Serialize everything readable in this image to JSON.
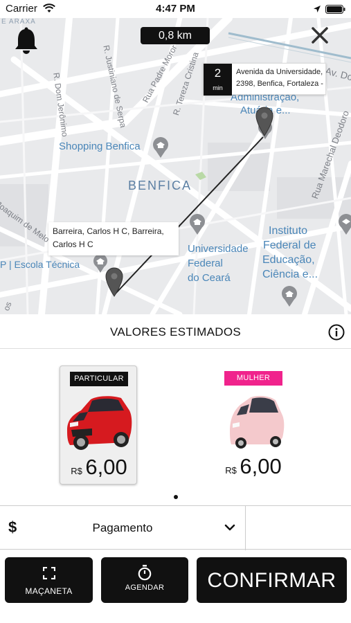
{
  "status_bar": {
    "carrier": "Carrier",
    "time": "4:47 PM",
    "icons": [
      "wifi-icon",
      "location-arrow-icon",
      "battery-icon"
    ]
  },
  "map": {
    "distance": "0,8 km",
    "destination": {
      "eta_value": "2",
      "eta_unit": "min",
      "address": "Avenida da Universidade, 2398, Benfica, Fortaleza -"
    },
    "origin": {
      "address": "Barreira, Carlos H C, Barreira, Carlos H C"
    },
    "labels": {
      "corner": "E ARAXÁ",
      "street1": "R. Dom Jerônimo",
      "street2": "R. Justiniano de Serpa",
      "street3": "Rua Padre Moror",
      "street4": "R. Tereza Cristina",
      "street5": "Av. Do",
      "street6": "Rua Marechal Deodoro",
      "street7": "Joaquim de Melo",
      "shopping": "Shopping Benfica",
      "district": "BENFICA",
      "admin1": "Administração,",
      "admin2": "Atuária e...",
      "univ1": "Universidade",
      "univ2": "Federal",
      "univ3": "do Ceará",
      "inst1": "Instituto",
      "inst2": "Federal de",
      "inst3": "Educação,",
      "inst4": "Ciência e...",
      "school": "P | Escola Técnica",
      "edge": "os"
    }
  },
  "estimates": {
    "title": "VALORES ESTIMADOS",
    "options": [
      {
        "badge": "PARTICULAR",
        "currency": "R$",
        "price": "6,00",
        "color": "#111111",
        "selected": true
      },
      {
        "badge": "MULHER",
        "currency": "R$",
        "price": "6,00",
        "color": "#f0238c",
        "selected": false
      }
    ]
  },
  "payment": {
    "symbol": "$",
    "label": "Pagamento"
  },
  "actions": {
    "handle_label": "MAÇANETA",
    "schedule_label": "AGENDAR",
    "confirm_label": "CONFIRMAR"
  }
}
